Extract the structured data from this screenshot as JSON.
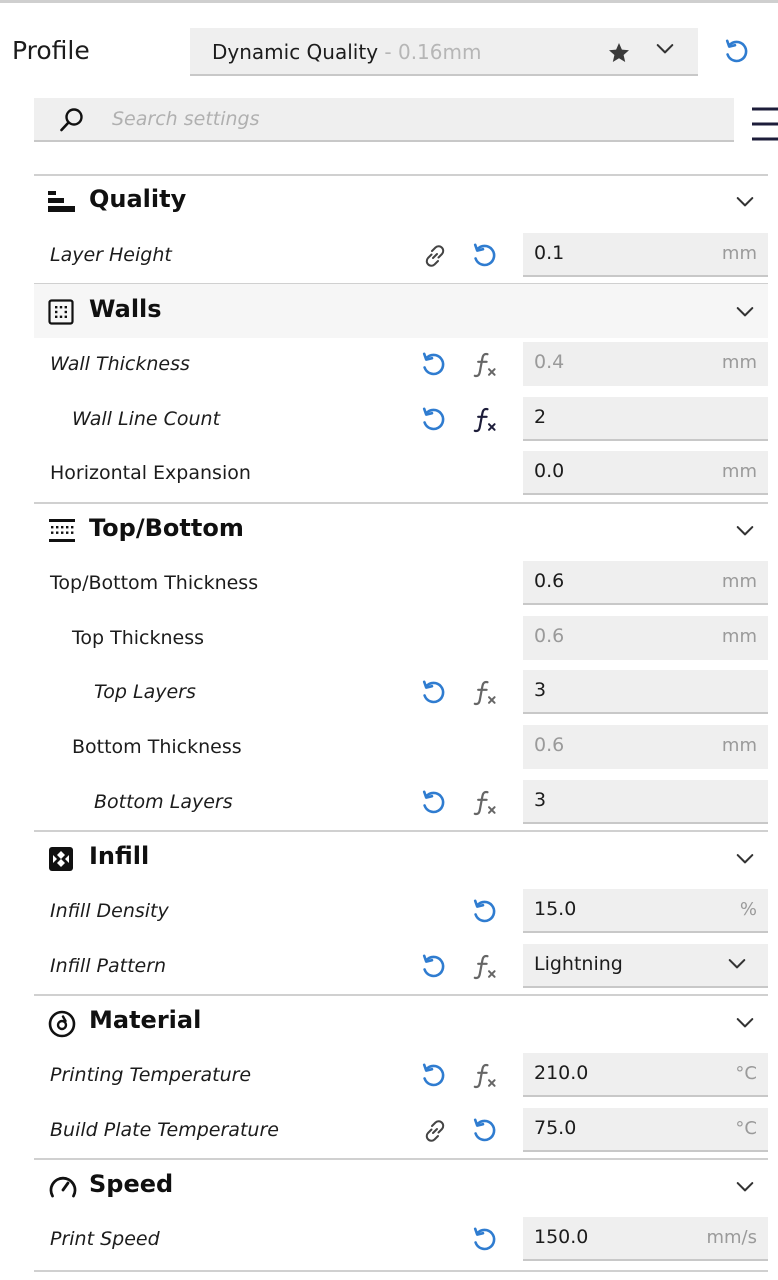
{
  "profile": {
    "label": "Profile",
    "name": "Dynamic Quality",
    "suffix": "- 0.16mm"
  },
  "search": {
    "placeholder": "Search settings"
  },
  "colors": {
    "accent": "#2f7cd0",
    "field_bg": "#efefef",
    "separator": "#d0d0d0"
  },
  "categories": {
    "quality": {
      "title": "Quality",
      "icon": "quality-icon"
    },
    "walls": {
      "title": "Walls",
      "icon": "walls-icon"
    },
    "topbottom": {
      "title": "Top/Bottom",
      "icon": "top-bottom-icon"
    },
    "infill": {
      "title": "Infill",
      "icon": "infill-icon"
    },
    "material": {
      "title": "Material",
      "icon": "material-icon"
    },
    "speed": {
      "title": "Speed",
      "icon": "speed-icon"
    }
  },
  "settings": {
    "layer_height": {
      "label": "Layer Height",
      "value": "0.1",
      "unit": "mm"
    },
    "wall_thickness": {
      "label": "Wall Thickness",
      "value": "0.4",
      "unit": "mm"
    },
    "wall_line_count": {
      "label": "Wall Line Count",
      "value": "2",
      "unit": ""
    },
    "horizontal_expansion": {
      "label": "Horizontal Expansion",
      "value": "0.0",
      "unit": "mm"
    },
    "top_bottom_thickness": {
      "label": "Top/Bottom Thickness",
      "value": "0.6",
      "unit": "mm"
    },
    "top_thickness": {
      "label": "Top Thickness",
      "value": "0.6",
      "unit": "mm"
    },
    "top_layers": {
      "label": "Top Layers",
      "value": "3",
      "unit": ""
    },
    "bottom_thickness": {
      "label": "Bottom Thickness",
      "value": "0.6",
      "unit": "mm"
    },
    "bottom_layers": {
      "label": "Bottom Layers",
      "value": "3",
      "unit": ""
    },
    "infill_density": {
      "label": "Infill Density",
      "value": "15.0",
      "unit": "%"
    },
    "infill_pattern": {
      "label": "Infill Pattern",
      "value": "Lightning"
    },
    "printing_temperature": {
      "label": "Printing Temperature",
      "value": "210.0",
      "unit": "°C"
    },
    "build_plate_temperature": {
      "label": "Build Plate Temperature",
      "value": "75.0",
      "unit": "°C"
    },
    "print_speed": {
      "label": "Print Speed",
      "value": "150.0",
      "unit": "mm/s"
    }
  }
}
